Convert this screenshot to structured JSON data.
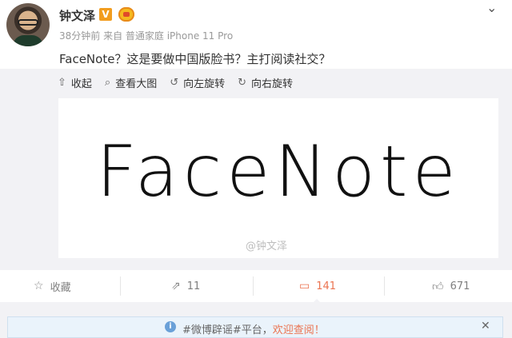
{
  "post": {
    "author": "钟文泽",
    "verified_badge": "V",
    "meta": "38分钟前 来自 普通家庭 iPhone 11 Pro",
    "text": "FaceNote？这是要做中国版脸书？主打阅读社交？"
  },
  "media_toolbar": {
    "collapse": "收起",
    "view_large": "查看大图",
    "rotate_left": "向左旋转",
    "rotate_right": "向右旋转"
  },
  "image": {
    "logo_text": "FaceNote",
    "watermark": "@钟文泽"
  },
  "actions": {
    "favorite": "收藏",
    "repost_count": "11",
    "comment_count": "141",
    "like_count": "671"
  },
  "notice": {
    "prefix": "#微博辟谣#平台，",
    "link": "欢迎查阅！",
    "close": "✕"
  },
  "icons": {
    "collapse": "up-arrow-icon",
    "view": "magnifier-icon",
    "rotate_left": "rotate-left-icon",
    "rotate_right": "rotate-right-icon",
    "favorite": "star-icon",
    "repost": "repost-icon",
    "comment": "comment-icon",
    "like": "thumb-up-icon",
    "info": "info-icon",
    "close": "close-icon"
  },
  "colors": {
    "accent": "#eb7350",
    "verified": "#f29d1f",
    "info": "#6aa0d8"
  }
}
